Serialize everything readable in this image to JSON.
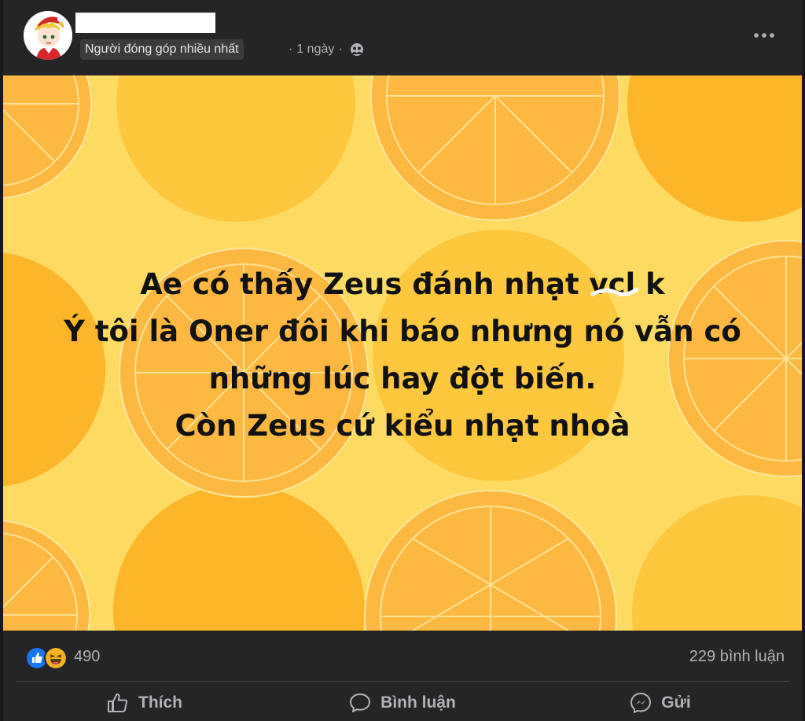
{
  "header": {
    "badge": "Người đóng góp nhiều nhất",
    "time_sep": "·",
    "time": "1 ngày",
    "time_sep2": "·",
    "audience_icon": "group-icon",
    "more_icon": "more-horizontal-icon"
  },
  "post": {
    "lines": [
      "Ae có thấy Zeus đánh nhạt vcl k",
      "Ý tôi là Oner đôi khi báo nhưng nó vẫn có",
      "những lúc hay đột biến.",
      "Còn Zeus cứ kiểu nhạt nhoà"
    ],
    "background_colors": {
      "base": "#fddb63",
      "orange_dark": "#fdb52a",
      "orange_mid": "#fec83e",
      "slice": "#fdb841",
      "slice_line": "#fde7a0"
    }
  },
  "stats": {
    "reaction_icons": [
      "like-icon",
      "haha-icon"
    ],
    "reaction_count": "490",
    "comments": "229 bình luận"
  },
  "actions": {
    "like_label": "Thích",
    "comment_label": "Bình luận",
    "send_label": "Gửi"
  },
  "colors": {
    "card_bg": "#242526",
    "page_bg": "#18191a",
    "text_secondary": "#b0b3b8",
    "like_blue": "#1877f2",
    "haha_yellow": "#f7b125"
  }
}
